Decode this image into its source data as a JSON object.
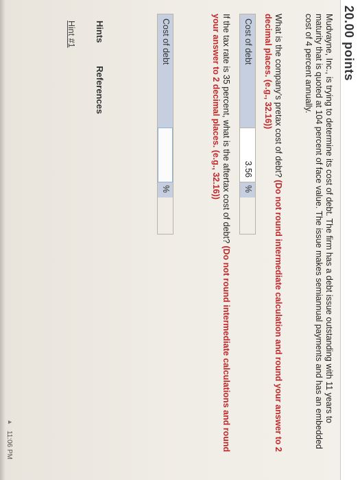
{
  "header": {
    "points": "20.00 points"
  },
  "problem": {
    "text": "Mudvayne, Inc., is trying to determine its cost of debt. The firm has a debt issue outstanding with 11 years to maturity that is quoted at 104 percent of face value. The issue makes semiannual payments and has an embedded cost of 4 percent annually."
  },
  "question1": {
    "text": "What is the company’s pretax cost of debt? ",
    "instruction": "(Do not round intermediate calculation and round your answer to 2 decimal places. (e.g., 32.16))",
    "label": "Cost of debt",
    "value": "3.56",
    "unit": "%"
  },
  "question2": {
    "text": "If the tax rate is 35 percent, what is the aftertax cost of debt? ",
    "instruction": "(Do not round intermediate calculations and round your answer to 2 decimal places. (e.g., 32.16))",
    "label": "Cost of debt",
    "value": "",
    "unit": "%"
  },
  "tabs": {
    "hints": "Hints",
    "references": "References"
  },
  "hint_link": "Hint #1",
  "status": {
    "time": "11:06 PM"
  }
}
